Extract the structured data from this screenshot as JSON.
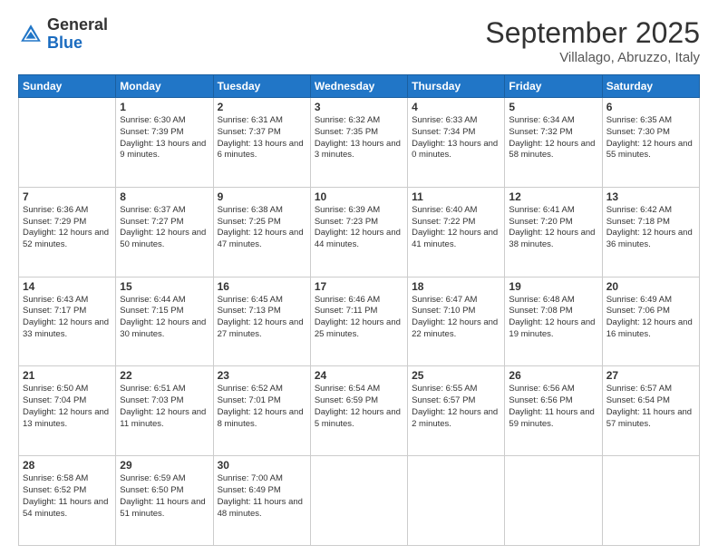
{
  "header": {
    "logo_general": "General",
    "logo_blue": "Blue",
    "month": "September 2025",
    "location": "Villalago, Abruzzo, Italy"
  },
  "weekdays": [
    "Sunday",
    "Monday",
    "Tuesday",
    "Wednesday",
    "Thursday",
    "Friday",
    "Saturday"
  ],
  "weeks": [
    [
      {
        "day": "",
        "sunrise": "",
        "sunset": "",
        "daylight": ""
      },
      {
        "day": "1",
        "sunrise": "Sunrise: 6:30 AM",
        "sunset": "Sunset: 7:39 PM",
        "daylight": "Daylight: 13 hours and 9 minutes."
      },
      {
        "day": "2",
        "sunrise": "Sunrise: 6:31 AM",
        "sunset": "Sunset: 7:37 PM",
        "daylight": "Daylight: 13 hours and 6 minutes."
      },
      {
        "day": "3",
        "sunrise": "Sunrise: 6:32 AM",
        "sunset": "Sunset: 7:35 PM",
        "daylight": "Daylight: 13 hours and 3 minutes."
      },
      {
        "day": "4",
        "sunrise": "Sunrise: 6:33 AM",
        "sunset": "Sunset: 7:34 PM",
        "daylight": "Daylight: 13 hours and 0 minutes."
      },
      {
        "day": "5",
        "sunrise": "Sunrise: 6:34 AM",
        "sunset": "Sunset: 7:32 PM",
        "daylight": "Daylight: 12 hours and 58 minutes."
      },
      {
        "day": "6",
        "sunrise": "Sunrise: 6:35 AM",
        "sunset": "Sunset: 7:30 PM",
        "daylight": "Daylight: 12 hours and 55 minutes."
      }
    ],
    [
      {
        "day": "7",
        "sunrise": "Sunrise: 6:36 AM",
        "sunset": "Sunset: 7:29 PM",
        "daylight": "Daylight: 12 hours and 52 minutes."
      },
      {
        "day": "8",
        "sunrise": "Sunrise: 6:37 AM",
        "sunset": "Sunset: 7:27 PM",
        "daylight": "Daylight: 12 hours and 50 minutes."
      },
      {
        "day": "9",
        "sunrise": "Sunrise: 6:38 AM",
        "sunset": "Sunset: 7:25 PM",
        "daylight": "Daylight: 12 hours and 47 minutes."
      },
      {
        "day": "10",
        "sunrise": "Sunrise: 6:39 AM",
        "sunset": "Sunset: 7:23 PM",
        "daylight": "Daylight: 12 hours and 44 minutes."
      },
      {
        "day": "11",
        "sunrise": "Sunrise: 6:40 AM",
        "sunset": "Sunset: 7:22 PM",
        "daylight": "Daylight: 12 hours and 41 minutes."
      },
      {
        "day": "12",
        "sunrise": "Sunrise: 6:41 AM",
        "sunset": "Sunset: 7:20 PM",
        "daylight": "Daylight: 12 hours and 38 minutes."
      },
      {
        "day": "13",
        "sunrise": "Sunrise: 6:42 AM",
        "sunset": "Sunset: 7:18 PM",
        "daylight": "Daylight: 12 hours and 36 minutes."
      }
    ],
    [
      {
        "day": "14",
        "sunrise": "Sunrise: 6:43 AM",
        "sunset": "Sunset: 7:17 PM",
        "daylight": "Daylight: 12 hours and 33 minutes."
      },
      {
        "day": "15",
        "sunrise": "Sunrise: 6:44 AM",
        "sunset": "Sunset: 7:15 PM",
        "daylight": "Daylight: 12 hours and 30 minutes."
      },
      {
        "day": "16",
        "sunrise": "Sunrise: 6:45 AM",
        "sunset": "Sunset: 7:13 PM",
        "daylight": "Daylight: 12 hours and 27 minutes."
      },
      {
        "day": "17",
        "sunrise": "Sunrise: 6:46 AM",
        "sunset": "Sunset: 7:11 PM",
        "daylight": "Daylight: 12 hours and 25 minutes."
      },
      {
        "day": "18",
        "sunrise": "Sunrise: 6:47 AM",
        "sunset": "Sunset: 7:10 PM",
        "daylight": "Daylight: 12 hours and 22 minutes."
      },
      {
        "day": "19",
        "sunrise": "Sunrise: 6:48 AM",
        "sunset": "Sunset: 7:08 PM",
        "daylight": "Daylight: 12 hours and 19 minutes."
      },
      {
        "day": "20",
        "sunrise": "Sunrise: 6:49 AM",
        "sunset": "Sunset: 7:06 PM",
        "daylight": "Daylight: 12 hours and 16 minutes."
      }
    ],
    [
      {
        "day": "21",
        "sunrise": "Sunrise: 6:50 AM",
        "sunset": "Sunset: 7:04 PM",
        "daylight": "Daylight: 12 hours and 13 minutes."
      },
      {
        "day": "22",
        "sunrise": "Sunrise: 6:51 AM",
        "sunset": "Sunset: 7:03 PM",
        "daylight": "Daylight: 12 hours and 11 minutes."
      },
      {
        "day": "23",
        "sunrise": "Sunrise: 6:52 AM",
        "sunset": "Sunset: 7:01 PM",
        "daylight": "Daylight: 12 hours and 8 minutes."
      },
      {
        "day": "24",
        "sunrise": "Sunrise: 6:54 AM",
        "sunset": "Sunset: 6:59 PM",
        "daylight": "Daylight: 12 hours and 5 minutes."
      },
      {
        "day": "25",
        "sunrise": "Sunrise: 6:55 AM",
        "sunset": "Sunset: 6:57 PM",
        "daylight": "Daylight: 12 hours and 2 minutes."
      },
      {
        "day": "26",
        "sunrise": "Sunrise: 6:56 AM",
        "sunset": "Sunset: 6:56 PM",
        "daylight": "Daylight: 11 hours and 59 minutes."
      },
      {
        "day": "27",
        "sunrise": "Sunrise: 6:57 AM",
        "sunset": "Sunset: 6:54 PM",
        "daylight": "Daylight: 11 hours and 57 minutes."
      }
    ],
    [
      {
        "day": "28",
        "sunrise": "Sunrise: 6:58 AM",
        "sunset": "Sunset: 6:52 PM",
        "daylight": "Daylight: 11 hours and 54 minutes."
      },
      {
        "day": "29",
        "sunrise": "Sunrise: 6:59 AM",
        "sunset": "Sunset: 6:50 PM",
        "daylight": "Daylight: 11 hours and 51 minutes."
      },
      {
        "day": "30",
        "sunrise": "Sunrise: 7:00 AM",
        "sunset": "Sunset: 6:49 PM",
        "daylight": "Daylight: 11 hours and 48 minutes."
      },
      {
        "day": "",
        "sunrise": "",
        "sunset": "",
        "daylight": ""
      },
      {
        "day": "",
        "sunrise": "",
        "sunset": "",
        "daylight": ""
      },
      {
        "day": "",
        "sunrise": "",
        "sunset": "",
        "daylight": ""
      },
      {
        "day": "",
        "sunrise": "",
        "sunset": "",
        "daylight": ""
      }
    ]
  ]
}
